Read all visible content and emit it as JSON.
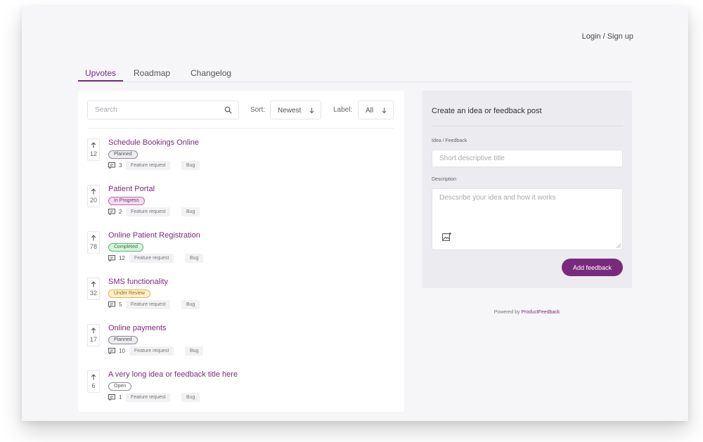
{
  "header": {
    "login_label": "Login / Sign up"
  },
  "tabs": [
    {
      "label": "Upvotes",
      "active": true
    },
    {
      "label": "Roadmap",
      "active": false
    },
    {
      "label": "Changelog",
      "active": false
    }
  ],
  "filters": {
    "search_placeholder": "Search",
    "sort_label": "Sort:",
    "sort_value": "Newest",
    "label_label": "Label:",
    "label_value": "All"
  },
  "posts": [
    {
      "votes": "12",
      "title": "Schedule Bookings Online",
      "status": "Planned",
      "comments": "3",
      "tags": [
        "Feature request",
        "Bug"
      ]
    },
    {
      "votes": "20",
      "title": "Patient Portal",
      "status": "In Progress",
      "comments": "2",
      "tags": [
        "Feature request",
        "Bug"
      ]
    },
    {
      "votes": "78",
      "title": "Online Patient Registration",
      "status": "Completed",
      "comments": "12",
      "tags": [
        "Feature request",
        "Bug"
      ]
    },
    {
      "votes": "32",
      "title": "SMS functionality",
      "status": "Under Review",
      "comments": "5",
      "tags": [
        "Feature request",
        "Bug"
      ]
    },
    {
      "votes": "17",
      "title": "Online payments",
      "status": "Planned",
      "comments": "10",
      "tags": [
        "Feature request",
        "Bug"
      ]
    },
    {
      "votes": "6",
      "title": "A very long idea or feedback title here",
      "status": "Open",
      "comments": "1",
      "tags": [
        "Feature request",
        "Bug"
      ]
    }
  ],
  "form": {
    "title": "Create an idea or feedback post",
    "idea_label": "Idea / Feedback",
    "idea_placeholder": "Short descriptive title",
    "description_label": "Description",
    "description_placeholder": "Descsribe your idea and how it works",
    "submit_label": "Add feedback"
  },
  "footer": {
    "powered_prefix": "Powered by",
    "powered_brand": "ProductFeedback"
  },
  "colors": {
    "accent": "#7a2a7c",
    "background": "#f6f6f9",
    "planned": "#ececf1",
    "in_progress": "#f4ddee",
    "completed": "#d9f4de",
    "under_review": "#fdf0cf"
  }
}
